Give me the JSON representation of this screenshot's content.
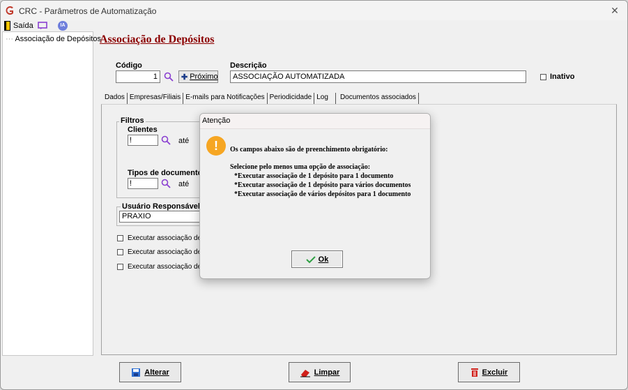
{
  "window": {
    "title": "CRC - Parâmetros de Automatização",
    "close_glyph": "✕"
  },
  "toolbar": {
    "exit_label": "Saída",
    "ia_label": "IA"
  },
  "sidebar": {
    "items": [
      {
        "prefix": "···",
        "label": "Associação de Depósitos"
      }
    ]
  },
  "main": {
    "heading": "Associação de Depósitos",
    "codigo_label": "Código",
    "codigo_value": "1",
    "proximo_label": "Próximo",
    "descricao_label": "Descrição",
    "descricao_value": "ASSOCIAÇÃO AUTOMATIZADA",
    "inativo_label": "Inativo"
  },
  "tabs": [
    "Dados",
    "Empresas/Filiais",
    "E-mails para Notificações",
    "Periodicidade",
    "Log",
    "Documentos associados"
  ],
  "dados": {
    "filtros_label": "Filtros",
    "clientes_label": "Clientes",
    "clientes_value": "!",
    "ate1": "até",
    "tipos_label": "Tipos de documentos",
    "tipos_value": "!",
    "ate2": "até",
    "usuario_label": "Usuário Responsável",
    "usuario_value": "PRAXIO",
    "checkboxes": [
      "Executar associação de",
      "Executar associação de",
      "Executar associação de v"
    ]
  },
  "buttons": {
    "alterar": "Alterar",
    "limpar": "Limpar",
    "excluir": "Excluir"
  },
  "dialog": {
    "title": "Atenção",
    "warn_glyph": "!",
    "line1": "Os campos abaixo são de preenchimento obrigatório:",
    "line2": "Selecione pelo menos uma opção de associação:",
    "line3": "*Executar associação de 1 depósito para 1 documento",
    "line4": "*Executar associação de 1 depósito para vários documentos",
    "line5": "*Executar associação de vários depósitos para 1 documento",
    "ok_label": "Ok"
  },
  "colors": {
    "heading": "#8b0000",
    "warning": "#f6a623",
    "magnifier": "#8a3fd1"
  }
}
